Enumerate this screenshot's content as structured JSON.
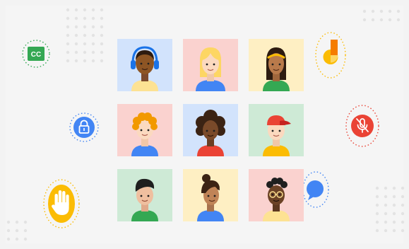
{
  "colors": {
    "blue": "#4285f4",
    "red": "#ea4335",
    "yellow": "#fbbc04",
    "green": "#34a853",
    "tile_blue": "#d2e3fc",
    "tile_pink": "#fad2cf",
    "tile_yellow": "#feefc3",
    "tile_green": "#ceead6"
  },
  "badges": {
    "captions": {
      "label": "CC",
      "icon": "closed-captions-icon"
    },
    "lock": {
      "icon": "lock-icon"
    },
    "hand": {
      "icon": "raise-hand-icon"
    },
    "jamboard": {
      "icon": "jamboard-logo-icon"
    },
    "mic": {
      "icon": "mic-off-icon"
    },
    "chat": {
      "icon": "chat-bubble-icon"
    }
  },
  "participants": [
    {
      "icon": "person-headphones-avatar"
    },
    {
      "icon": "person-blonde-avatar"
    },
    {
      "icon": "person-headband-avatar"
    },
    {
      "icon": "person-curly-ginger-avatar"
    },
    {
      "icon": "person-afro-avatar"
    },
    {
      "icon": "person-red-cap-avatar"
    },
    {
      "icon": "person-black-hair-avatar"
    },
    {
      "icon": "person-bun-avatar"
    },
    {
      "icon": "person-glasses-avatar"
    }
  ]
}
